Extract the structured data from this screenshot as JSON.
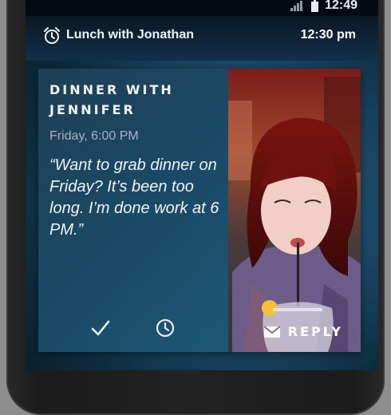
{
  "status_bar": {
    "time": "12:49",
    "icons": [
      "signal-icon",
      "battery-icon"
    ]
  },
  "notification": {
    "icon": "alarm-clock-icon",
    "title": "Lunch with Jonathan",
    "time": "12:30 pm"
  },
  "card": {
    "title": "DINNER WITH JENNIFER",
    "when": "Friday, 6:00 PM",
    "quote": "“Want to grab dinner on Friday? It’s been too long. I’m done work at 6 PM.”",
    "actions": {
      "confirm_icon": "checkmark-icon",
      "snooze_icon": "clock-icon",
      "reply_label": "REPLY",
      "reply_icon": "envelope-icon"
    }
  },
  "colors": {
    "screen_accent": "#2f7a9e",
    "card_panel": "#1a4a66",
    "text_primary": "#f2f5f7",
    "text_muted": "#9fb3c1"
  }
}
